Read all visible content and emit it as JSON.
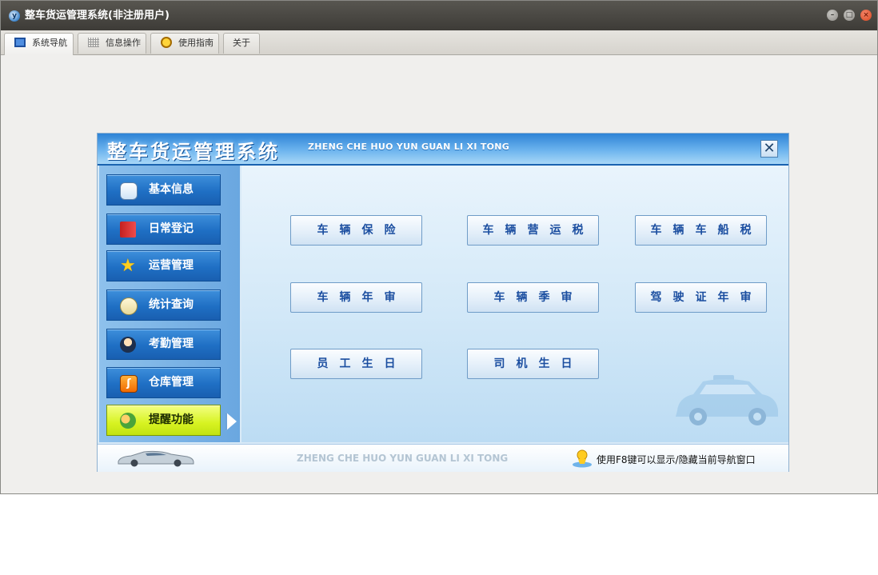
{
  "window": {
    "title": "整车货运管理系统(非注册用户)",
    "app_icon": "yf-app-icon",
    "controls": [
      "minimize-icon",
      "maximize-icon",
      "close-icon"
    ]
  },
  "tabs": [
    {
      "label": "系统导航",
      "icon": "monitor-icon",
      "active": true
    },
    {
      "label": "信息操作",
      "icon": "grid-icon",
      "active": false
    },
    {
      "label": "使用指南",
      "icon": "sun-icon",
      "active": false
    },
    {
      "label": "关于",
      "icon": "",
      "active": false
    }
  ],
  "panel": {
    "title": "整车货运管理系统",
    "subtitle": "ZHENG CHE HUO YUN GUAN LI XI TONG",
    "close_label": "✕"
  },
  "sidebar": {
    "items": [
      {
        "label": "基本信息",
        "icon": "id-card-icon"
      },
      {
        "label": "日常登记",
        "icon": "book-icon"
      },
      {
        "label": "运营管理",
        "icon": "star-icon"
      },
      {
        "label": "统计查询",
        "icon": "chat-bubble-icon"
      },
      {
        "label": "考勤管理",
        "icon": "user-icon"
      },
      {
        "label": "仓库管理",
        "icon": "rss-icon"
      },
      {
        "label": "提醒功能",
        "icon": "people-icon",
        "active": true
      }
    ],
    "accent_active": "#d7f321",
    "accent_normal": "#1f6fc4"
  },
  "functions": [
    {
      "label": "车辆保险"
    },
    {
      "label": "车辆营运税"
    },
    {
      "label": "车辆车船税"
    },
    {
      "label": "车辆年审"
    },
    {
      "label": "车辆季审"
    },
    {
      "label": "驾驶证年审"
    },
    {
      "label": "员工生日"
    },
    {
      "label": "司机生日"
    }
  ],
  "footer": {
    "subtitle": "ZHENG CHE HUO YUN GUAN LI XI TONG",
    "hint": "使用F8键可以显示/隐藏当前导航窗口"
  }
}
